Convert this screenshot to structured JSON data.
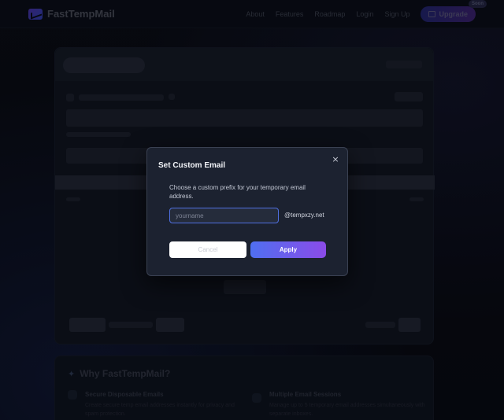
{
  "header": {
    "brand": "FastTempMail",
    "nav": [
      "About",
      "Features",
      "Roadmap",
      "Login",
      "Sign Up"
    ],
    "upgrade_label": "Upgrade",
    "soon_badge": "Soon"
  },
  "why": {
    "title": "Why FastTempMail?",
    "features": [
      {
        "title": "Secure Disposable Emails",
        "text": "Create secure temp email addresses instantly for privacy and spam protection."
      },
      {
        "title": "Multiple Email Sessions",
        "text": "Manage up to 5 temporary email addresses simultaneously with separate inboxes."
      }
    ]
  },
  "modal": {
    "title": "Set Custom Email",
    "description": "Choose a custom prefix for your temporary email address.",
    "input_placeholder": "yourname",
    "input_value": "",
    "domain": "@tempxzy.net",
    "cancel_label": "Cancel",
    "apply_label": "Apply",
    "close_glyph": "×"
  },
  "colors": {
    "accent_start": "#4f6ff0",
    "accent_end": "#8b4be8",
    "modal_bg": "#1c2230"
  }
}
